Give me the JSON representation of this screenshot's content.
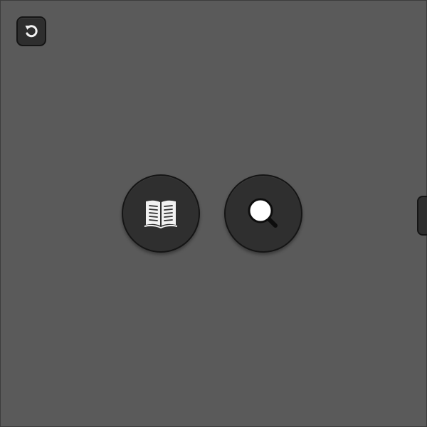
{
  "toolbar": {
    "back_button_icon": "undo-arrow-icon"
  },
  "actions": [
    {
      "name": "book",
      "icon": "open-book-icon"
    },
    {
      "name": "search",
      "icon": "magnifier-icon"
    }
  ],
  "side_panel": {
    "handle_icon": "panel-handle"
  },
  "colors": {
    "background": "#5a5a5a",
    "button_fill": "#2f2f2f",
    "button_border": "#151515",
    "icon_fill": "#f2f2f2"
  }
}
